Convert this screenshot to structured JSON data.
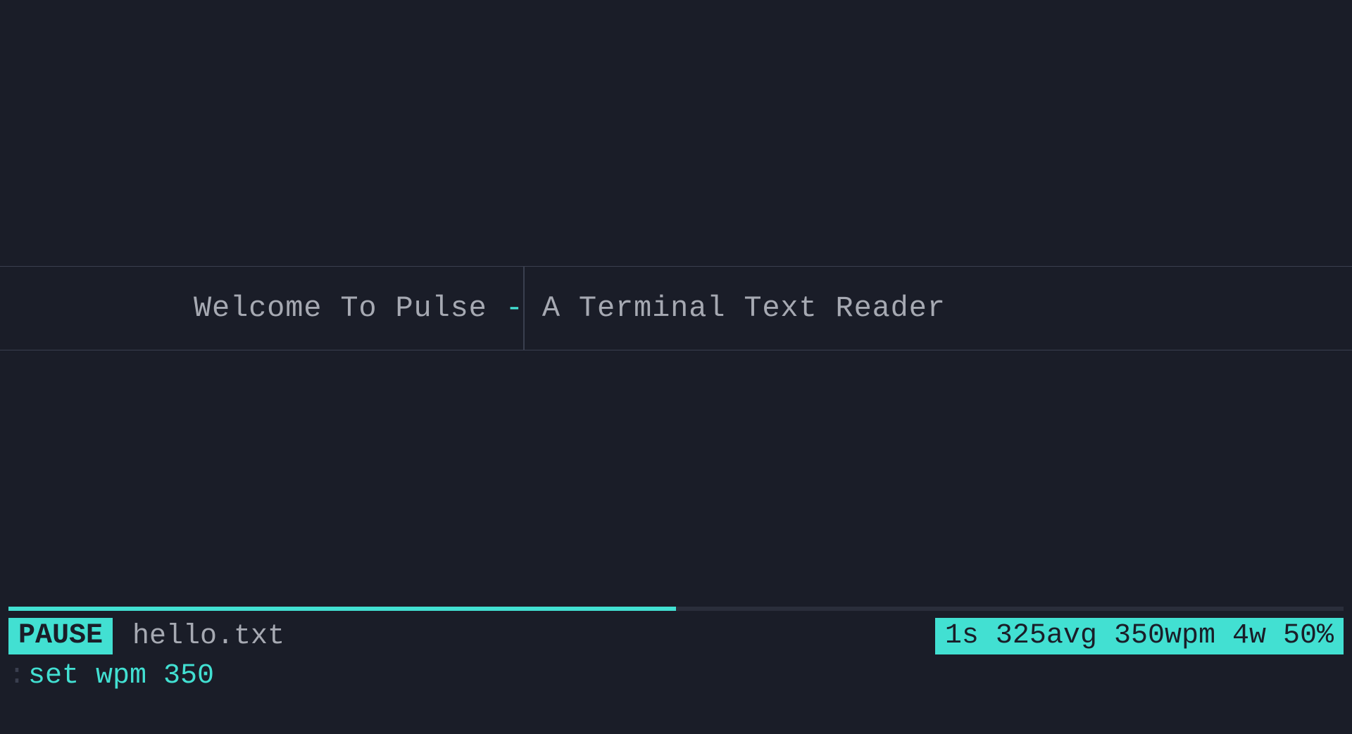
{
  "colors": {
    "bg": "#1a1d28",
    "text": "#a6a9b2",
    "accent": "#42e0d2",
    "divider": "#3a3f4f"
  },
  "reader": {
    "text_pre": "Welcome To Pulse ",
    "text_orp": "-",
    "text_post": " A Terminal Text Reader"
  },
  "progress": {
    "percent": 50
  },
  "status": {
    "mode": "PAUSE",
    "file": "hello.txt",
    "stats": "1s 325avg 350wpm 4w 50%"
  },
  "command": {
    "prefix": ":",
    "value": "set wpm 350"
  }
}
